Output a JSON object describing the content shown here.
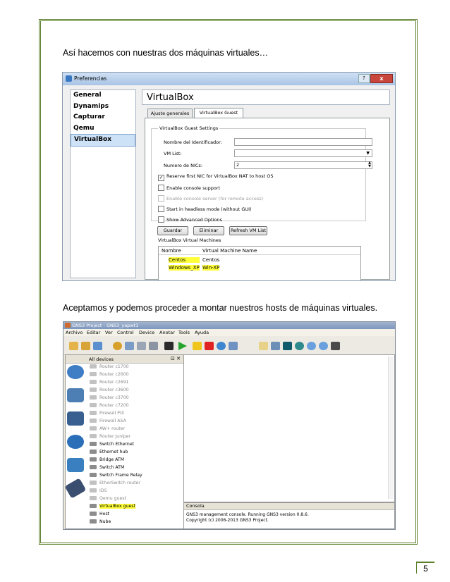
{
  "paragraph_1": "Así hacemos con nuestras dos máquinas virtuales…",
  "paragraph_2": "Aceptamos y podemos proceder a montar nuestros hosts de máquinas virtuales.",
  "page_number": "5",
  "colors": {
    "border": "#5b7f2a",
    "highlight": "#ffff3a"
  },
  "vbox_window": {
    "title": "Preferencias",
    "help_button": "?",
    "close_button": "x",
    "sidebar": [
      "General",
      "Dynamips",
      "Capturar",
      "Qemu",
      "VirtualBox"
    ],
    "selected_sidebar": "VirtualBox",
    "heading": "VirtualBox",
    "tabs": [
      "Ajuste generales",
      "VirtualBox Guest"
    ],
    "active_tab": "VirtualBox Guest",
    "group_title": "VirtualBox Guest Settings",
    "fields": {
      "identifier_label": "Nombre del Identificador:",
      "identifier_value": "",
      "vmlist_label": "VM List:",
      "vmlist_value": "",
      "nics_label": "Numero de NICs:",
      "nics_value": "2"
    },
    "checkboxes": [
      {
        "label": "Reserve first NIC for VirtualBox NAT to host OS",
        "checked": true,
        "disabled": false
      },
      {
        "label": "Enable console support",
        "checked": false,
        "disabled": false
      },
      {
        "label": "Enable console server (for remote access)",
        "checked": false,
        "disabled": true
      },
      {
        "label": "Start in headless mode (without GUI)",
        "checked": false,
        "disabled": false
      },
      {
        "label": "Show Advanced Options",
        "checked": false,
        "disabled": false
      }
    ],
    "buttons": {
      "save": "Guardar",
      "delete": "Eliminar",
      "refresh": "Refresh VM List"
    },
    "vm_table": {
      "title": "VirtualBox Virtual Machines",
      "columns": [
        "Nombre",
        "Virtual Machine Name"
      ],
      "rows": [
        [
          "Centos",
          "Centos"
        ],
        [
          "Windows_XP",
          "Win-XP"
        ]
      ]
    }
  },
  "gns3_window": {
    "title": "GNS3 Project - GNS3_yapwt1",
    "menu": [
      "Archivo",
      "Editar",
      "Ver",
      "Control",
      "Device",
      "Anotar",
      "Tools",
      "Ayuda"
    ],
    "devices_panel_title": "All devices",
    "panel_controls": "⊡ ✕",
    "devices": [
      {
        "label": "Router c1700",
        "enabled": false
      },
      {
        "label": "Router c2600",
        "enabled": false
      },
      {
        "label": "Router c2691",
        "enabled": false
      },
      {
        "label": "Router c3600",
        "enabled": false
      },
      {
        "label": "Router c3700",
        "enabled": false
      },
      {
        "label": "Router c7200",
        "enabled": false
      },
      {
        "label": "Firewall PIX",
        "enabled": false
      },
      {
        "label": "Firewall ASA",
        "enabled": false
      },
      {
        "label": "AW+ router",
        "enabled": false
      },
      {
        "label": "Router Juniper",
        "enabled": false
      },
      {
        "label": "Switch Ethernet",
        "enabled": true
      },
      {
        "label": "Ethernet hub",
        "enabled": true
      },
      {
        "label": "Bridge ATM",
        "enabled": true
      },
      {
        "label": "Switch ATM",
        "enabled": true
      },
      {
        "label": "Switch Frame Relay",
        "enabled": true
      },
      {
        "label": "EtherSwitch router",
        "enabled": false
      },
      {
        "label": "IDS",
        "enabled": false
      },
      {
        "label": "Qemu guest",
        "enabled": false
      },
      {
        "label": "VirtualBox guest",
        "enabled": true
      },
      {
        "label": "Host",
        "enabled": true
      },
      {
        "label": "Nube",
        "enabled": true
      }
    ],
    "highlighted_device": "VirtualBox guest",
    "console": {
      "title": "Consola",
      "lines": [
        "GNS3 management console. Running GNS3 version 0.8.6.",
        "Copyright (c) 2006-2013 GNS3 Project."
      ]
    }
  }
}
